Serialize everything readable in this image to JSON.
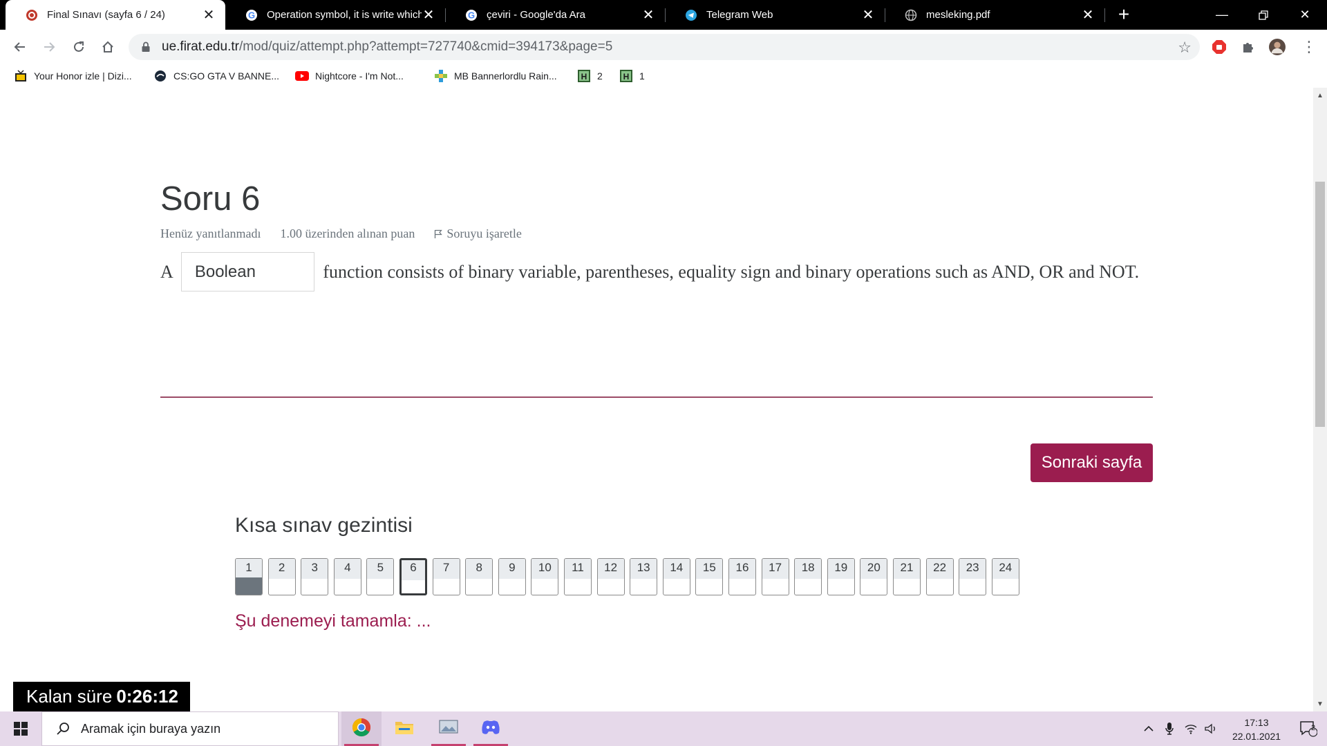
{
  "browser": {
    "tabs": [
      {
        "title": "Final Sınavı (sayfa 6 / 24)",
        "active": true,
        "icon": "moodle-icon"
      },
      {
        "title": "Operation symbol, it is write which o",
        "active": false,
        "icon": "google-icon"
      },
      {
        "title": "çeviri - Google'da Ara",
        "active": false,
        "icon": "google-icon"
      },
      {
        "title": "Telegram Web",
        "active": false,
        "icon": "telegram-icon"
      },
      {
        "title": "mesleking.pdf",
        "active": false,
        "icon": "globe-icon"
      }
    ],
    "url_host": "ue.firat.edu.tr",
    "url_path": "/mod/quiz/attempt.php?attempt=727740&cmid=394173&page=5",
    "bookmarks": [
      {
        "label": "Your Honor izle | Dizi...",
        "icon": "tv-icon"
      },
      {
        "label": "CS:GO GTA V BANNE...",
        "icon": "csgo-icon"
      },
      {
        "label": "Nightcore - I'm Not...",
        "icon": "youtube-icon"
      },
      {
        "label": "MB Bannerlordlu Rain...",
        "icon": "plus-icon"
      },
      {
        "label": "2",
        "icon": "h-icon"
      },
      {
        "label": "1",
        "icon": "h-icon"
      }
    ]
  },
  "question": {
    "title": "Soru 6",
    "status": "Henüz yanıtlanmadı",
    "points": "1.00 üzerinden alınan puan",
    "flag_label": "Soruyu işaretle",
    "text_before": "A",
    "answer_value": "Boolean",
    "text_after": "function consists of binary variable, parentheses, equality sign and binary operations such as AND, OR and NOT."
  },
  "next_button": "Sonraki sayfa",
  "quiz_nav": {
    "title": "Kısa sınav gezintisi",
    "items": [
      "1",
      "2",
      "3",
      "4",
      "5",
      "6",
      "7",
      "8",
      "9",
      "10",
      "11",
      "12",
      "13",
      "14",
      "15",
      "16",
      "17",
      "18",
      "19",
      "20",
      "21",
      "22",
      "23",
      "24"
    ],
    "answered": [
      "1"
    ],
    "current": "6",
    "finish_label": "Şu denemeyi tamamla: ..."
  },
  "timer": {
    "label": "Kalan süre",
    "value": "0:26:12"
  },
  "taskbar": {
    "search_placeholder": "Aramak için buraya yazın",
    "time": "17:13",
    "date": "22.01.2021",
    "notification_count": "2"
  },
  "colors": {
    "accent": "#9b1d4f",
    "divider": "#9b4a66",
    "tabbar": "#000000",
    "taskbar": "#e6d9ea"
  }
}
